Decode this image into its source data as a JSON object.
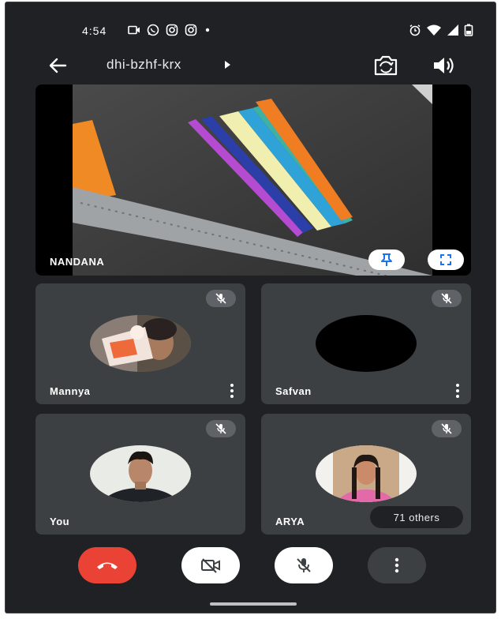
{
  "status_bar": {
    "time": "4:54"
  },
  "app_bar": {
    "meeting_code": "dhi-bzhf-krx"
  },
  "main_tile": {
    "participant": "NANDANA"
  },
  "tiles": [
    {
      "name": "Mannya"
    },
    {
      "name": "Safvan"
    },
    {
      "name": "You"
    },
    {
      "name": "ARYA",
      "others_label": "71 others"
    }
  ],
  "colors": {
    "background": "#202124",
    "tile": "#3c4043",
    "end_call": "#ea4335",
    "control_light": "#ffffff",
    "control_dark": "#3c4043"
  },
  "icons": {
    "status_left": [
      "video-camera-icon",
      "whatsapp-icon",
      "instagram-icon",
      "instagram-icon",
      "dot-icon"
    ],
    "status_right": [
      "alarm-icon",
      "wifi-icon",
      "signal-icon",
      "battery-icon"
    ],
    "app_bar": [
      "back-arrow-icon",
      "caret-right-icon",
      "camera-switch-icon",
      "speaker-icon"
    ],
    "main_tile": [
      "pin-icon",
      "fullscreen-icon"
    ],
    "controls": [
      "end-call-icon",
      "camera-off-icon",
      "mic-off-icon",
      "more-vert-icon"
    ]
  }
}
